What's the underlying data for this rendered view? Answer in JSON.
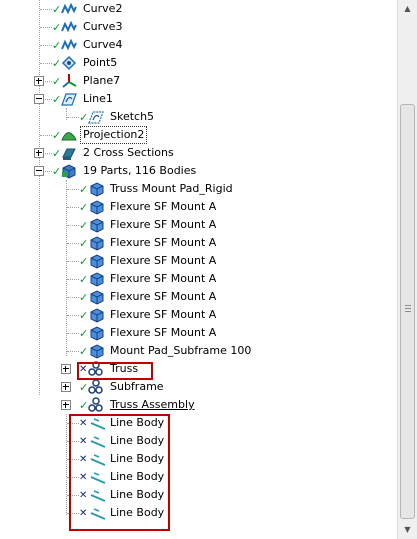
{
  "tree": {
    "items": [
      {
        "label": "Curve2"
      },
      {
        "label": "Curve3"
      },
      {
        "label": "Curve4"
      },
      {
        "label": "Point5"
      },
      {
        "label": "Plane7"
      },
      {
        "label": "Line1"
      },
      {
        "label": "Sketch5"
      },
      {
        "label": "Projection2"
      },
      {
        "label": "2 Cross Sections"
      },
      {
        "label": "19 Parts, 116 Bodies"
      },
      {
        "label": "Truss Mount Pad_Rigid"
      },
      {
        "label": "Flexure SF Mount A"
      },
      {
        "label": "Flexure SF Mount A"
      },
      {
        "label": "Flexure SF Mount A"
      },
      {
        "label": "Flexure SF Mount A"
      },
      {
        "label": "Flexure SF Mount A"
      },
      {
        "label": "Flexure SF Mount A"
      },
      {
        "label": "Flexure SF Mount A"
      },
      {
        "label": "Flexure SF Mount A"
      },
      {
        "label": "Mount Pad_Subframe 100"
      },
      {
        "label": "Truss"
      },
      {
        "label": "Subframe"
      },
      {
        "label": "Truss Assembly"
      },
      {
        "label": "Line Body"
      },
      {
        "label": "Line Body"
      },
      {
        "label": "Line Body"
      },
      {
        "label": "Line Body"
      },
      {
        "label": "Line Body"
      },
      {
        "label": "Line Body"
      }
    ]
  },
  "icons": {
    "check": "✓",
    "cross": "✕",
    "check_color": "#0a9a2a",
    "cross_color": "#14297a",
    "highlight_color": "#c00000"
  }
}
